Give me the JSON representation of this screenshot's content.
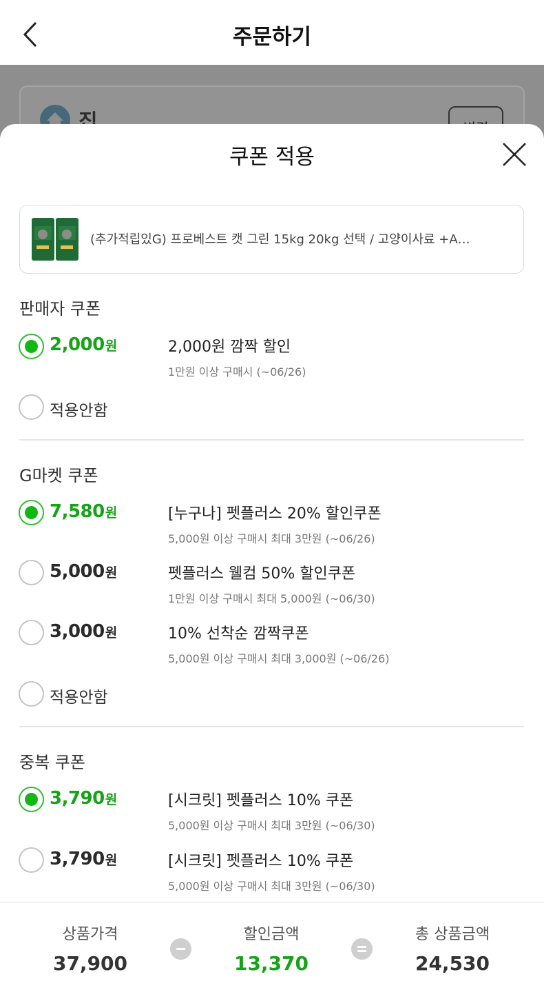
{
  "page": {
    "title": "주문하기"
  },
  "address": {
    "name": "집",
    "change_label": "변경"
  },
  "modal": {
    "title": "쿠폰 적용",
    "product_name": "(추가적립있G) 프로베스트 캣 그린 15kg 20kg 선택 / 고양이사료 +A…"
  },
  "sections": [
    {
      "title": "판매자 쿠폰",
      "coupons": [
        {
          "selected": true,
          "amount": "2,000",
          "unit": "원",
          "name": "2,000원 깜짝 할인",
          "condition": "1만원 이상 구매시 (~06/26)"
        }
      ],
      "none_label": "적용안함"
    },
    {
      "title": "G마켓 쿠폰",
      "coupons": [
        {
          "selected": true,
          "amount": "7,580",
          "unit": "원",
          "name": "[누구나] 펫플러스 20% 할인쿠폰",
          "condition": "5,000원 이상 구매시 최대 3만원 (~06/26)"
        },
        {
          "selected": false,
          "amount": "5,000",
          "unit": "원",
          "name": "펫플러스 웰컴 50% 할인쿠폰",
          "condition": "1만원 이상 구매시 최대 5,000원 (~06/30)"
        },
        {
          "selected": false,
          "amount": "3,000",
          "unit": "원",
          "name": "10% 선착순 깜짝쿠폰",
          "condition": "5,000원 이상 구매시 최대 3,000원 (~06/26)"
        }
      ],
      "none_label": "적용안함"
    },
    {
      "title": "중복 쿠폰",
      "coupons": [
        {
          "selected": true,
          "amount": "3,790",
          "unit": "원",
          "name": "[시크릿] 펫플러스 10% 쿠폰",
          "condition": "5,000원 이상 구매시 최대 3만원 (~06/30)"
        },
        {
          "selected": false,
          "amount": "3,790",
          "unit": "원",
          "name": "[시크릿] 펫플러스 10% 쿠폰",
          "condition": "5,000원 이상 구매시 최대 3만원 (~06/30)"
        }
      ]
    }
  ],
  "summary": {
    "product_price_label": "상품가격",
    "product_price": "37,900",
    "discount_label": "할인금액",
    "discount": "13,370",
    "total_label": "총 상품금액",
    "total": "24,530"
  },
  "colors": {
    "accent_green": "#17a317",
    "dim_overlay": "#8e8e8e"
  },
  "icons": {
    "back": "chevron-left-icon",
    "close": "close-icon",
    "home": "home-icon",
    "minus": "minus-circle-icon",
    "equals": "equals-circle-icon"
  }
}
